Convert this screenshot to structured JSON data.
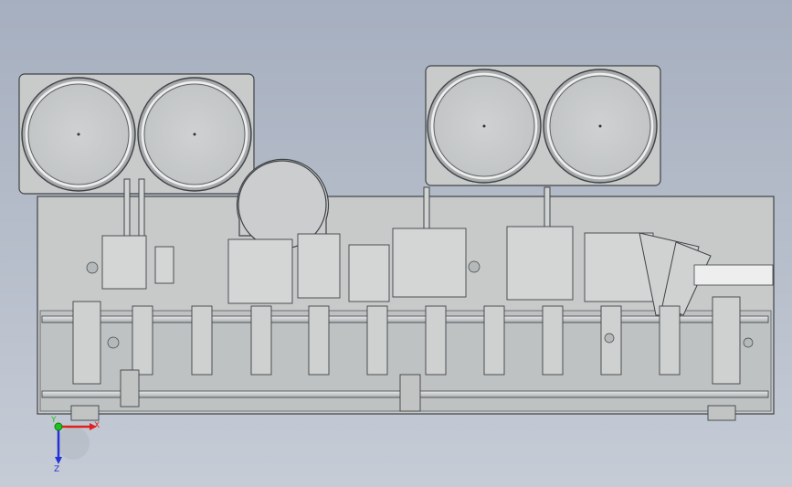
{
  "viewport": {
    "background_top": "#a6afbf",
    "background_bottom": "#c6ccd6"
  },
  "colors": {
    "plate": "#c9cbcb",
    "plate_dark": "#9fa3a5",
    "edge": "#3f4346",
    "bowl_rim": "#eeeeee",
    "red_axis": "#e0201a",
    "green_axis": "#1ec21e",
    "blue_axis": "#2430d8"
  },
  "triad": {
    "x_label": "X",
    "y_label": "Y",
    "z_label": "Z",
    "icon": "axis-triad-icon"
  },
  "assembly": {
    "feeder_bowls": 4,
    "large_drum": 1,
    "stations": 11,
    "conveyor_lanes": 2
  }
}
